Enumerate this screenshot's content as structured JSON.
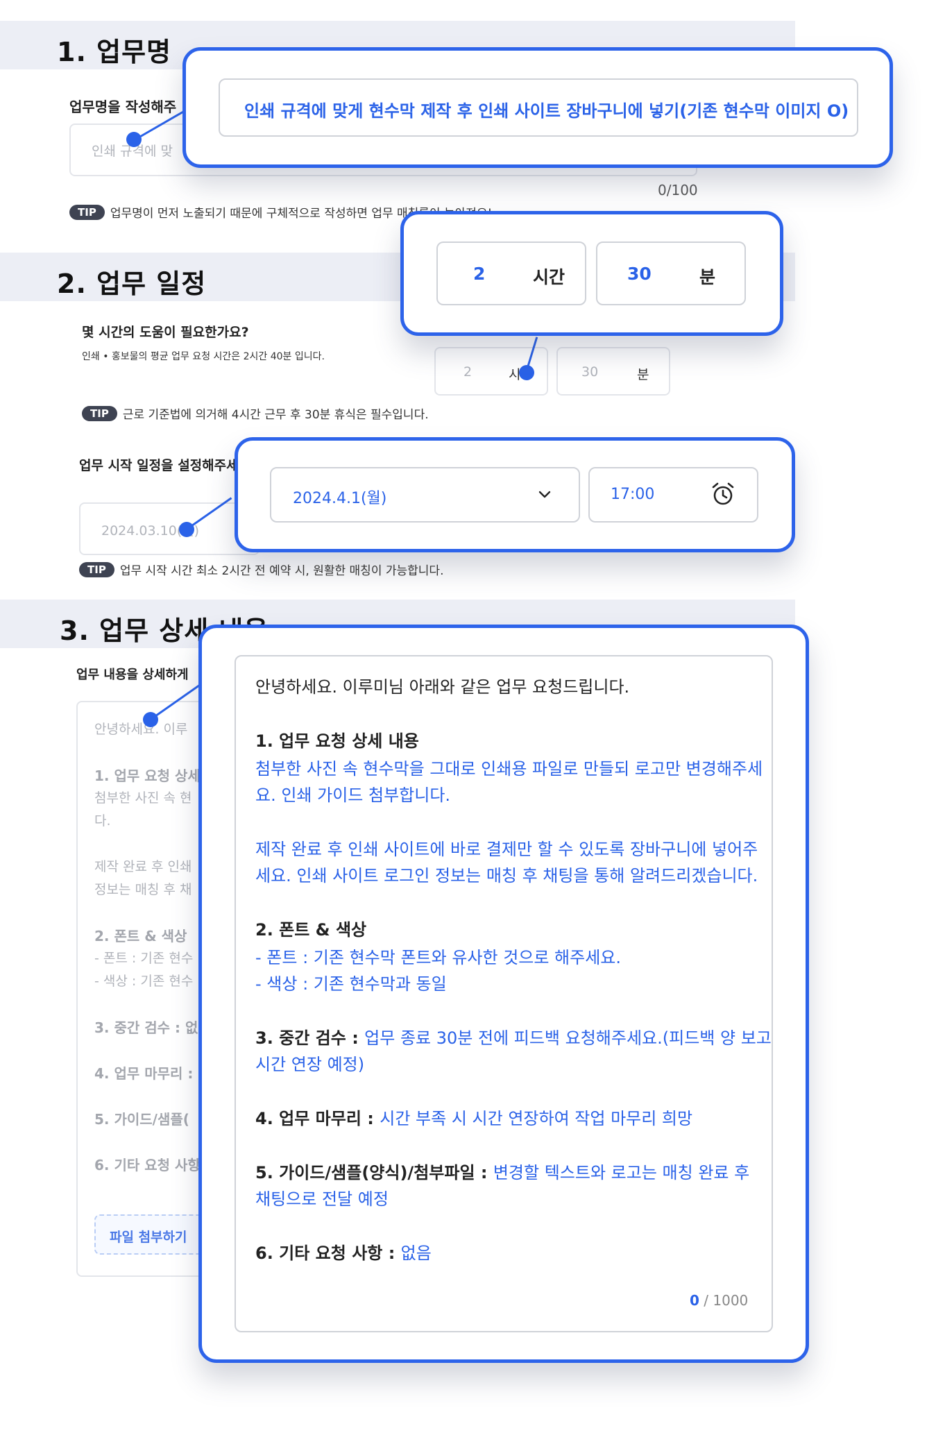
{
  "section1": {
    "title": "1. 업무명",
    "field_label": "업무명을 작성해주",
    "input_placeholder": "인쇄 규격에 맞",
    "counter": "0/100",
    "tip_badge": "TIP",
    "tip_text": "업무명이 먼저 노출되기 때문에 구체적으로 작성하면 업무 매칭률이 높아져요!",
    "callout_value": "인쇄 규격에 맞게 현수막 제작 후 인쇄 사이트 장바구니에 넣기(기존 현수막 이미지 O)"
  },
  "section2": {
    "title": "2. 업무 일정",
    "hours_question": "몇 시간의 도움이 필요한가요?",
    "hours_note": "인쇄 • 홍보물의 평균 업무 요청 시간은 2시간 40분 입니다.",
    "faint_hours_value": "2",
    "faint_hours_unit": "시",
    "faint_minutes_value": "30",
    "faint_minutes_unit": "분",
    "callout_hours_value": "2",
    "callout_hours_unit": "시간",
    "callout_minutes_value": "30",
    "callout_minutes_unit": "분",
    "tip_badge": "TIP",
    "tip_text": "근로 기준법에 의거해 4시간 근무 후 30분 휴식은 필수입니다.",
    "start_label": "업무 시작 일정을 설정해주세",
    "faint_date": "2024.03.10(일)",
    "callout_date": "2024.4.1(월)",
    "callout_time": "17:00",
    "tip2_badge": "TIP",
    "tip2_text": "업무 시작 시간 최소 2시간 전 예약 시, 원활한 매칭이 가능합니다."
  },
  "section3": {
    "title": "3. 업무 상세 내용",
    "field_label": "업무 내용을 상세하게",
    "faint": {
      "greeting": "안녕하세요. 이루",
      "item1_head": "1. 업무 요청 상세",
      "item1_l1": "첨부한 사진 속 현",
      "item1_l2": "다.",
      "item1_l3": "제작 완료 후 인쇄",
      "item1_l4": "정보는 매칭 후 채",
      "item2_head": "2. 폰트 & 색상",
      "item2_l1": "- 폰트 : 기존 현수",
      "item2_l2": "- 색상 : 기존 현수",
      "item3": "3. 중간 검수 : 없",
      "item4": "4. 업무 마무리 :",
      "item5": "5. 가이드/샘플(",
      "item6": "6. 기타 요청 사항",
      "attach_button": "파일 첨부하기"
    },
    "detail": {
      "greeting": "안녕하세요. 이루미님 아래와 같은 업무 요청드립니다.",
      "item1_head": "1. 업무 요청 상세 내용",
      "item1_l1": "첨부한 사진 속 현수막을 그대로 인쇄용 파일로 만들되 로고만 변경해주세",
      "item1_l2": "요. 인쇄 가이드 첨부합니다.",
      "item1_l3": "제작 완료 후 인쇄 사이트에 바로 결제만 할 수 있도록 장바구니에 넣어주",
      "item1_l4": "세요. 인쇄 사이트 로그인 정보는 매칭 후 채팅을 통해 알려드리겠습니다.",
      "item2_head": "2. 폰트 & 색상",
      "item2_l1": "- 폰트 : 기존 현수막 폰트와 유사한 것으로 해주세요.",
      "item2_l2": "- 색상 : 기존 현수막과 동일",
      "item3_head": "3. 중간 검수 : ",
      "item3_l1": "업무 종료 30분 전에 피드백 요청해주세요.(피드백 양 보고",
      "item3_l2": "시간 연장 예정)",
      "item4_head": "4. 업무 마무리 : ",
      "item4_value": "시간 부족 시 시간 연장하여 작업 마무리 희망",
      "item5_head": "5. 가이드/샘플(양식)/첨부파일 : ",
      "item5_l1": "변경할 텍스트와 로고는 매칭 완료 후",
      "item5_l2": "채팅으로 전달 예정",
      "item6_head": "6.  기타 요청 사항 : ",
      "item6_value": "없음",
      "counter_current": "0",
      "counter_total": " / 1000"
    }
  },
  "colors": {
    "accent": "#2a62e8",
    "section_bar": "#eceef5",
    "tip_badge": "#3e4352"
  }
}
